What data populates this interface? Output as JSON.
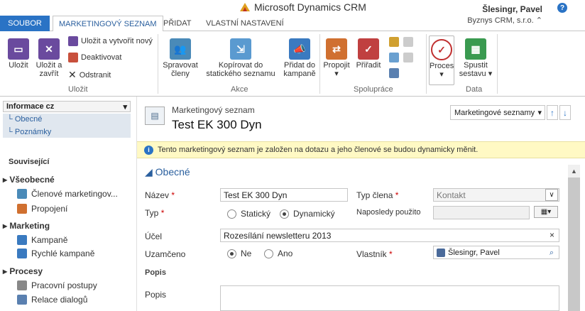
{
  "app": {
    "logo": "Microsoft Dynamics CRM",
    "user_name": "Šlesingr, Pavel",
    "org": "Byznys CRM, s.r.o."
  },
  "tabs": {
    "file": "SOUBOR",
    "marketing_list": "MARKETINGOVÝ SEZNAM",
    "add": "PŘIDAT",
    "custom": "VLASTNÍ NASTAVENÍ"
  },
  "ribbon": {
    "save": "Uložit",
    "save_close": "Uložit a zavřít",
    "save_new": "Uložit a vytvořit nový",
    "deactivate": "Deaktivovat",
    "delete": "Odstranit",
    "group_save": "Uložit",
    "manage_members": "Spravovat členy",
    "copy_static": "Kopírovat do statického seznamu",
    "add_campaign": "Přidat do kampaně",
    "group_actions": "Akce",
    "connect": "Propojit",
    "assign": "Přiřadit",
    "group_collab": "Spolupráce",
    "process": "Proces",
    "run_report": "Spustit sestavu",
    "group_data": "Data"
  },
  "nav": {
    "info_header": "Informace cz",
    "general": "Obecné",
    "notes": "Poznámky",
    "related": "Související",
    "sec_general": "Všeobecné",
    "members": "Členové marketingov...",
    "connections": "Propojení",
    "sec_marketing": "Marketing",
    "campaigns": "Kampaně",
    "quick_campaigns": "Rychlé kampaně",
    "sec_processes": "Procesy",
    "workflows": "Pracovní postupy",
    "dialogs": "Relace dialogů"
  },
  "header": {
    "entity": "Marketingový seznam",
    "title": "Test EK 300 Dyn",
    "view_select": "Marketingové seznamy"
  },
  "banner": "Tento marketingový seznam je založen na dotazu a jeho členové se budou dynamicky měnit.",
  "form": {
    "section": "Obecné",
    "name_label": "Název",
    "name_value": "Test EK 300 Dyn",
    "member_type_label": "Typ člena",
    "member_type_value": "Kontakt",
    "type_label": "Typ",
    "type_static": "Statický",
    "type_dynamic": "Dynamický",
    "last_used_label": "Naposledy použito",
    "purpose_label": "Účel",
    "purpose_value": "Rozesílání newsletteru 2013",
    "locked_label": "Uzamčeno",
    "locked_no": "Ne",
    "locked_yes": "Ano",
    "owner_label": "Vlastník",
    "owner_value": "Šlesingr, Pavel",
    "desc_section": "Popis",
    "desc_label": "Popis"
  },
  "colors": {
    "accent": "#2a73c5",
    "banner": "#fff9c4"
  }
}
